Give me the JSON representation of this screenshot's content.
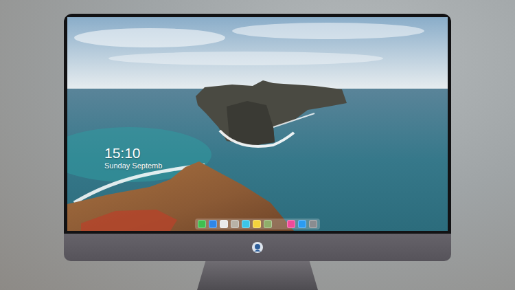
{
  "screen": {
    "clock": {
      "time": "15:10",
      "date": "Sunday Septemb"
    }
  },
  "dock": {
    "groups": [
      [
        {
          "color": "#3fbf4f"
        },
        {
          "color": "#2f86e6"
        },
        {
          "color": "#e9e9e9"
        },
        {
          "color": "#b8b2a6"
        },
        {
          "color": "#3cc6e8"
        },
        {
          "color": "#f4d23c"
        },
        {
          "color": "#8fae6a"
        }
      ],
      [
        {
          "color": "#f04a9a"
        },
        {
          "color": "#2b9cf2"
        },
        {
          "color": "#8a8c90"
        }
      ]
    ]
  }
}
